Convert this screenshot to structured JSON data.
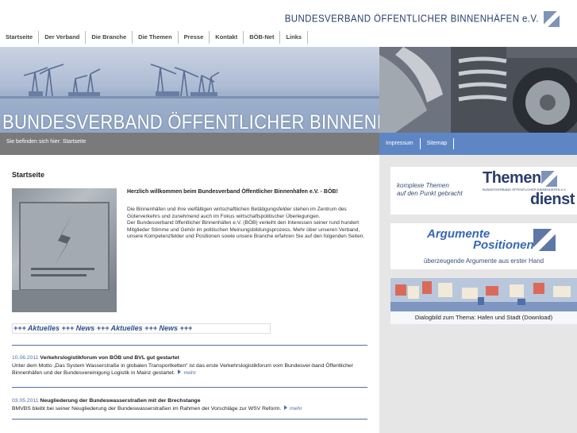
{
  "header": {
    "logo_text": "BUNDESVERBAND ÖFFENTLICHER BINNENHÄFEN e.V.",
    "nav": [
      "Startseite",
      "Der Verband",
      "Die Branche",
      "Die Themen",
      "Presse",
      "Kontakt",
      "BÖB-Net",
      "Links"
    ]
  },
  "banner": {
    "title": "BUNDESVERBAND ÖFFENTLICHER BINNENHÄFEN E.V."
  },
  "breadcrumb": "Sie befinden sich hier: Startseite",
  "right_links": [
    "Impressum",
    "Sitemap"
  ],
  "main": {
    "title": "Startseite",
    "intro_head": "Herzlich willkommen beim Bundesverband Öffentlicher Binnenhäfen e.V. - BÖB!",
    "intro_p1": "Die Binnenhäfen und ihre vielfältigen wirtschaftlichen Betätigungsfelder stehen im Zentrum des Güterverkehrs und zunehmend auch im Fokus wirtschaftspolitischer Überlegungen.",
    "intro_p2": "Der Bundesverband öffentlicher Binnenhäfen e.V. (BÖB) verleiht den Interessen seiner rund hundert Mitglieder Stimme und Gehör im politischen Meinungsbildungsprozess. Mehr über unseren Verband, unsere Kompetenzfelder und Positionen sowie unsere Branche erfahren Sie auf den folgenden Seiten.",
    "ticker": "+++ Aktuelles +++ News +++ Aktuelles +++ News +++",
    "news": [
      {
        "date": "10.06.2011",
        "headline": "Verkehrslogistikforum von BÖB und BVL gut gestartet",
        "text": "Unter dem Motto „Das System Wasserstraße in globalen Transportketten“ ist das erste Verkehrslogistikforum vom Bundesver-band Öffentlicher Binnenhäfen und der Bundesvereinigung Logistik in Mainz gestartet.",
        "more": "mehr"
      },
      {
        "date": "03.05.2011",
        "headline": "Neugliederung der Bundeswasserstraßen mit der Brechstange",
        "text": "BMVBS bleibt bei seiner Neugliederung der Bundeswasserstraßen im Rahmen der Vorschläge zur WSV Reform.",
        "more": "mehr"
      }
    ]
  },
  "sidebar": {
    "card1_line1": "komplexe Themen",
    "card1_line2": "auf den Punkt gebracht",
    "card1_big1": "Themen",
    "card1_big2": "dienst",
    "card1_mini": "BUNDESVERBAND ÖFFENTLICHER BINNENHÄFEN e.V.",
    "card2_line1": "Argumente",
    "card2_line2": "Positionen",
    "card2_caption": "überzeugende Argumente aus erster Hand",
    "card3_caption": "Dialogbild zum Thema: Hafen und Stadt (Download)"
  },
  "colors": {
    "accent": "#4f6fa8",
    "nav_blue": "#5f86c4",
    "crumb_grey": "#7a7a7a",
    "sidebar_bg": "#e6e6e6"
  }
}
